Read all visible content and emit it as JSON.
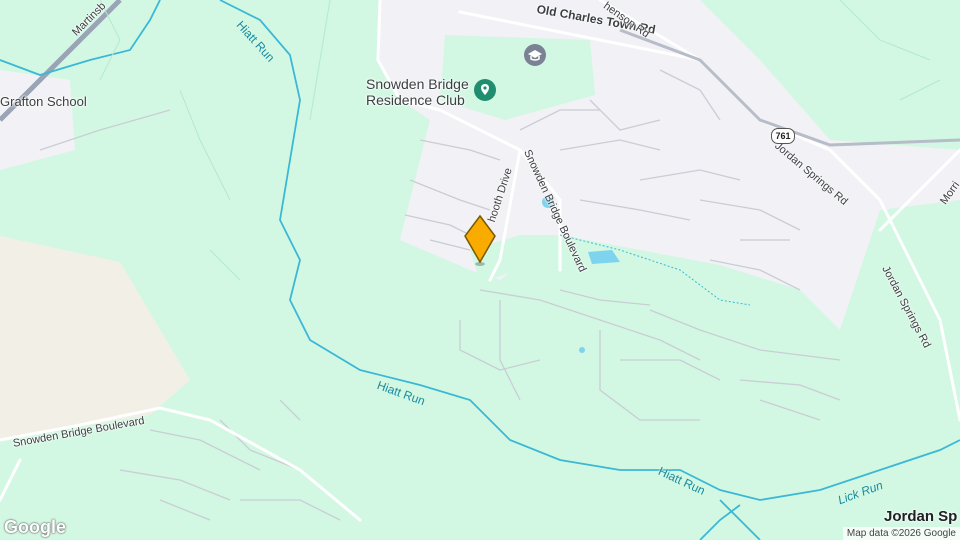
{
  "map": {
    "colors": {
      "land": "#d2f8e3",
      "urban": "#f2f1f5",
      "farmland": "#f2efe6",
      "water": "#3bb8d6",
      "road": "#ffffff",
      "minor_road": "#c9cdd4",
      "highway": "#9aa4b5",
      "marker": "#f9ab00",
      "poi_green": "#1e8e6e",
      "poi_gray": "#7a8294"
    },
    "labels": {
      "old_charles_town_rd": "Old Charles Town Rd",
      "stephenson_rd": "henson Rd",
      "martinsburg": "Martinsb",
      "grafton_school": "Grafton School",
      "hiatt_run_top": "Hiatt Run",
      "hiatt_run_mid": "Hiatt Run",
      "hiatt_run_bottom": "Hiatt Run",
      "lick_run": "Lick Run",
      "snowden_bridge_residence_club": "Snowden Bridge\nResidence Club",
      "hooth_drive": "hooth Drive",
      "snowden_bridge_blvd_right": "Snowden Bridge Boulevard",
      "snowden_bridge_blvd_left": "Snowden Bridge Boulevard",
      "jordan_springs_rd_upper": "Jordan Springs Rd",
      "jordan_springs_rd_lower": "Jordan Springs Rd",
      "morris": "Morri",
      "jordan_springs_town": "Jordan Sp",
      "route_761": "761"
    },
    "icons": {
      "school_icon": "school-icon",
      "club_icon": "location-pin-icon",
      "marker_icon": "map-marker-icon"
    },
    "logo": "Google",
    "attribution": "Map data ©2026 Google"
  }
}
